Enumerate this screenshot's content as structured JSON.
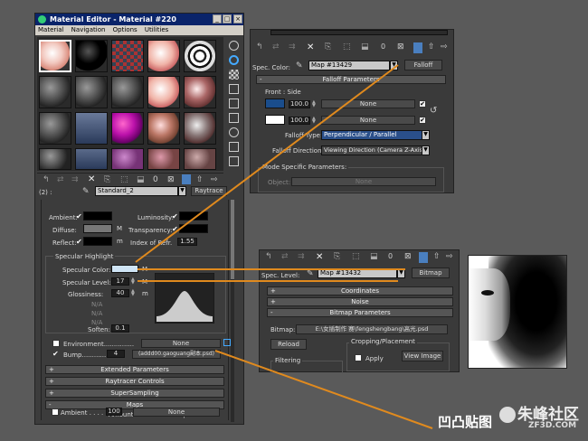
{
  "mat_editor": {
    "title": "Material Editor - Material #220",
    "menu": [
      "Material",
      "Navigation",
      "Options",
      "Utilities"
    ],
    "slot_label": "(2) :",
    "material_name": "Standard_2",
    "material_type": "Raytrace",
    "ambient": "Ambient:",
    "diffuse": "Diffuse:",
    "reflect": "Reflect:",
    "m": "M",
    "m_lower": "m",
    "luminosity": "Luminosity:",
    "transparency": "Transparency:",
    "ior_label": "Index of Refr.",
    "ior_value": "1.55",
    "specular_highlight": "Specular Highlight",
    "specular_color": "Specular Color:",
    "specular_level": "Specular Level:",
    "specular_level_val": "17",
    "glossiness": "Glossiness:",
    "glossiness_val": "40",
    "aniso_a": "N/A",
    "aniso_b": "N/A",
    "aniso_c": "N/A",
    "soften": "Soften:",
    "soften_val": "0.1",
    "environment": "Environment...............",
    "env_map": "None",
    "bump": "Bump..............",
    "bump_val": "4",
    "bump_map": "(addd00.gaoguang副本.psd)",
    "rollouts": [
      "Extended Parameters",
      "Raytracer Controls",
      "SuperSampling",
      "Maps"
    ],
    "maps_amount": "Amount",
    "maps_map": "Map",
    "maps_ambient": "Ambient . . . . . .",
    "maps_ambient_val": "100",
    "maps_ambient_map": "None"
  },
  "falloff_panel": {
    "spec_color": "Spec. Color:",
    "map_name": "Map #13429",
    "map_type": "Falloff",
    "params_title": "Falloff Parameters",
    "front_side": "Front : Side",
    "val1": "100.0",
    "val2": "100.0",
    "none1": "None",
    "none2": "None",
    "falloff_type_label": "Falloff Type:",
    "falloff_type": "Perpendicular / Parallel",
    "falloff_dir_label": "Falloff Direction:",
    "falloff_dir": "Viewing Direction (Camera Z-Axis)",
    "mode_specific": "Mode Specific Parameters:",
    "object_label": "Object:",
    "object_val": "None",
    "o_label": "0"
  },
  "bitmap_panel": {
    "spec_level": "Spec. Level:",
    "map_name": "Map #13432",
    "map_type": "Bitmap",
    "rollouts": [
      "Coordinates",
      "Noise",
      "Bitmap Parameters"
    ],
    "bitmap_label": "Bitmap:",
    "bitmap_path": "E:\\女插制作 赛\\fengshengbang\\高光.psd",
    "reload": "Reload",
    "cropping": "Cropping/Placement",
    "apply": "Apply",
    "view_image": "View Image",
    "filtering": "Filtering",
    "o_label": "0"
  },
  "watermark": {
    "left": "凹凸贴图",
    "brand": "朱峰社区",
    "url": "ZF3D.COM"
  },
  "colors": {
    "leader": "#e08a1e",
    "title_bg": "#0a246a",
    "spec_swatch": "#cfe4f5",
    "falloff_swatch": "#1a4d8c",
    "dropdown_hl": "#2a4f8a"
  }
}
